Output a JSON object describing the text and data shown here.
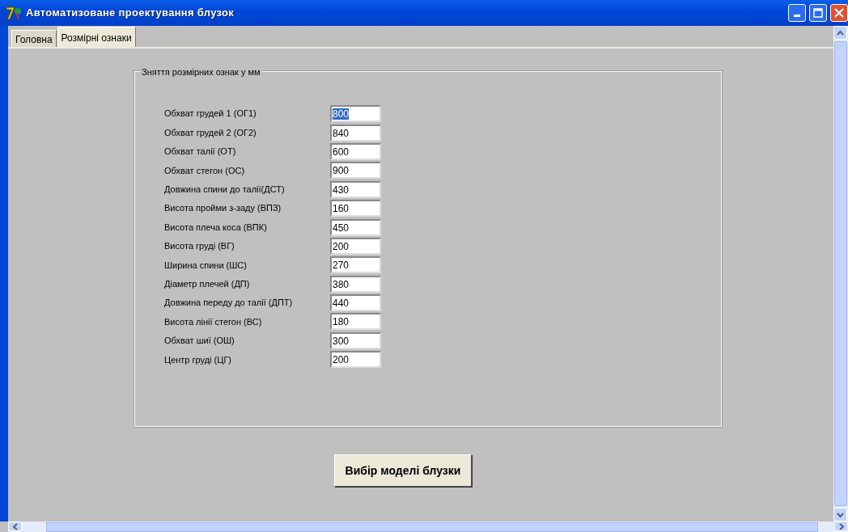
{
  "window": {
    "title": "Автоматизоване проектування блузок"
  },
  "tabs": [
    {
      "label": "Головна",
      "selected": false
    },
    {
      "label": "Розмірні ознаки",
      "selected": true
    }
  ],
  "group": {
    "title": "Зняття розмірних ознак у мм",
    "fields": [
      {
        "label": "Обхват грудей 1 (ОГ1)",
        "value": "800",
        "selected": true
      },
      {
        "label": "Обхват грудей 2 (ОГ2)",
        "value": "840",
        "selected": false
      },
      {
        "label": "Обхват талії (ОТ)",
        "value": "600",
        "selected": false
      },
      {
        "label": "Обхват стегон (ОС)",
        "value": "900",
        "selected": false
      },
      {
        "label": "Довжина спини до талії(ДСТ)",
        "value": "430",
        "selected": false
      },
      {
        "label": "Висота пройми з-заду (ВПЗ)",
        "value": "160",
        "selected": false
      },
      {
        "label": "Висота плеча коса (ВПК)",
        "value": "450",
        "selected": false
      },
      {
        "label": "Висота груді (ВГ)",
        "value": "200",
        "selected": false
      },
      {
        "label": "Ширина спини (ШС)",
        "value": "270",
        "selected": false
      },
      {
        "label": "Діаметр плечей (ДП)",
        "value": "380",
        "selected": false
      },
      {
        "label": "Довжина переду до талії (ДПТ)",
        "value": "440",
        "selected": false
      },
      {
        "label": "Висота лінії стегон (ВС)",
        "value": "180",
        "selected": false
      },
      {
        "label": "Обхват шиї (ОШ)",
        "value": "300",
        "selected": false
      },
      {
        "label": "Центр груді (ЦГ)",
        "value": "200",
        "selected": false
      }
    ]
  },
  "button": {
    "label": "Вибір моделі блузки"
  }
}
